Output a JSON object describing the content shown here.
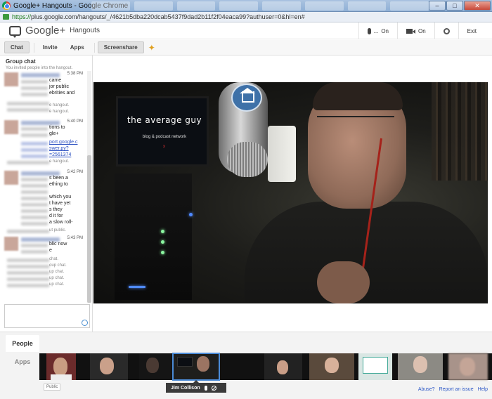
{
  "window": {
    "title": "Google+ Hangouts - Google Chrome",
    "url_scheme": "https://",
    "url_rest": "plus.google.com/hangouts/_/4621b5dba220dcab5437f9dad2b11f2f04eaca99?authuser=0&hl=en#"
  },
  "header": {
    "brand": "Google+",
    "app_name": "Hangouts",
    "mic_status": "On",
    "mic_dots": "...",
    "camera_status": "On",
    "exit_label": "Exit"
  },
  "toolbar": {
    "chat": "Chat",
    "invite": "Invite",
    "apps": "Apps",
    "screenshare": "Screenshare"
  },
  "chat": {
    "title": "Group chat",
    "system_note": "You invited people into the hangout.",
    "messages": [
      {
        "time": "5:38 PM",
        "lines": [
          "came",
          "jor public",
          "ebrities and"
        ],
        "meta": [
          "e hangout.",
          "e hangout."
        ]
      },
      {
        "time": "5:40 PM",
        "lines": [
          "tions to",
          "gle+"
        ],
        "links": [
          "port.google.c",
          "swer.py?",
          "=2561374"
        ],
        "meta": [
          "e hangout."
        ]
      },
      {
        "time": "5:42 PM",
        "lines": [
          "s been a",
          "ething to",
          "",
          "which you",
          "t have yet",
          "s they",
          "d it for",
          "a slow roll-"
        ],
        "meta": [
          "ut public."
        ]
      },
      {
        "time": "5:43 PM",
        "lines": [
          "blic now",
          "e"
        ],
        "meta": [
          "chat.",
          "oup chat.",
          "up chat.",
          "up chat.",
          "up chat."
        ]
      }
    ]
  },
  "bottom": {
    "people_tab": "People",
    "apps_tab": "Apps",
    "public_badge": "Public",
    "featured_name": "Jim Collison",
    "links": [
      "Abuse?",
      "Report an issue",
      "Help"
    ]
  },
  "video_overlay": {
    "monitor_text": "the average guy",
    "monitor_sub": "blog & podcast network",
    "monitor_mark": "x"
  },
  "colors": {
    "accent": "#4a8ad6",
    "link": "#2a56c6",
    "cable": "#a5221a"
  }
}
